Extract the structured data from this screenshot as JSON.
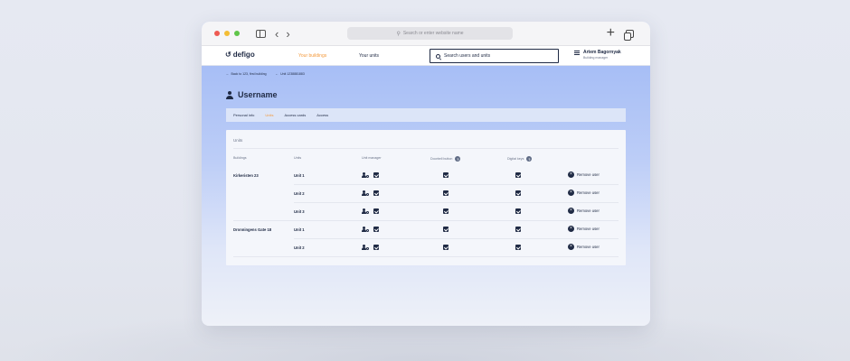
{
  "browser": {
    "address_placeholder": "Search or enter website name",
    "colors": {
      "close": "#ee5a52",
      "minimize": "#f3bd34",
      "zoom": "#5fc54a"
    }
  },
  "header": {
    "logo": "defigo",
    "nav": {
      "buildings": "Your buildings",
      "units": "Your units"
    },
    "search_placeholder": "Search users and units",
    "user": {
      "name": "Artem Bagornyak",
      "role": "Building manager"
    },
    "accent_color": "#f39a3d"
  },
  "breadcrumb": {
    "back": "Back to 123, first building",
    "unit": "Unit 1238881883"
  },
  "page": {
    "title": "Username",
    "tabs": [
      {
        "label": "Personal info",
        "active": false
      },
      {
        "label": "Units",
        "active": true
      },
      {
        "label": "Access cards",
        "active": false
      },
      {
        "label": "Access",
        "active": false
      }
    ]
  },
  "units_table": {
    "title": "Units",
    "headers": {
      "buildings": "Buildings",
      "units": "Units",
      "unit_manager": "Unit manager",
      "doorbell_button": "Doorbell button",
      "digital_keys": "Digital keys"
    },
    "help_icon_glyph": "?",
    "remove_label": "Remove user",
    "rows": [
      {
        "building": "Kirkeristen 23",
        "unit": "Unit 1",
        "unit_manager": true,
        "doorbell": true,
        "digital_keys": true
      },
      {
        "building": "",
        "unit": "Unit 2",
        "unit_manager": true,
        "doorbell": true,
        "digital_keys": true
      },
      {
        "building": "",
        "unit": "Unit 3",
        "unit_manager": true,
        "doorbell": true,
        "digital_keys": true
      },
      {
        "building": "Dronningens Gate 18",
        "unit": "Unit 1",
        "unit_manager": true,
        "doorbell": true,
        "digital_keys": true
      },
      {
        "building": "",
        "unit": "Unit 2",
        "unit_manager": true,
        "doorbell": true,
        "digital_keys": true
      }
    ]
  }
}
